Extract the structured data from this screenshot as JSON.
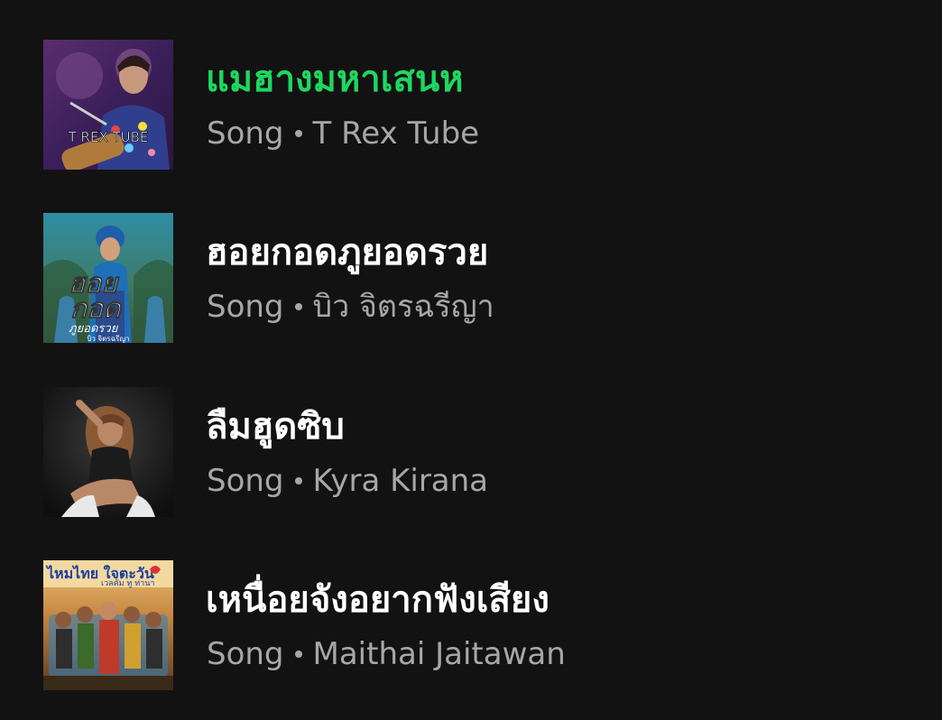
{
  "results": [
    {
      "title": "แมฮางมหาเสนห",
      "type": "Song",
      "artist": "T Rex Tube",
      "playing": true,
      "art_icon": "album-art-t-rex-tube",
      "art_text": "T REX TUBE"
    },
    {
      "title": "ฮอยกอดภูยอดรวย",
      "type": "Song",
      "artist": "บิว จิตรฉรีญา",
      "playing": false,
      "art_icon": "album-art-hoy-kod",
      "art_text": "ฮอย กอด ภูยอดรวย"
    },
    {
      "title": "ลืมฮูดซิบ",
      "type": "Song",
      "artist": "Kyra Kirana",
      "playing": false,
      "art_icon": "album-art-kyra-kirana"
    },
    {
      "title": "เหนื่อยจังอยากฟังเสียง",
      "type": "Song",
      "artist": "Maithai Jaitawan",
      "playing": false,
      "art_icon": "album-art-maithai",
      "art_text": "ไหมไทย ใจตะวัน"
    }
  ],
  "colors": {
    "background": "#121212",
    "playing_title": "#1ed760",
    "title": "#ffffff",
    "subtitle": "#a7a7a7"
  }
}
